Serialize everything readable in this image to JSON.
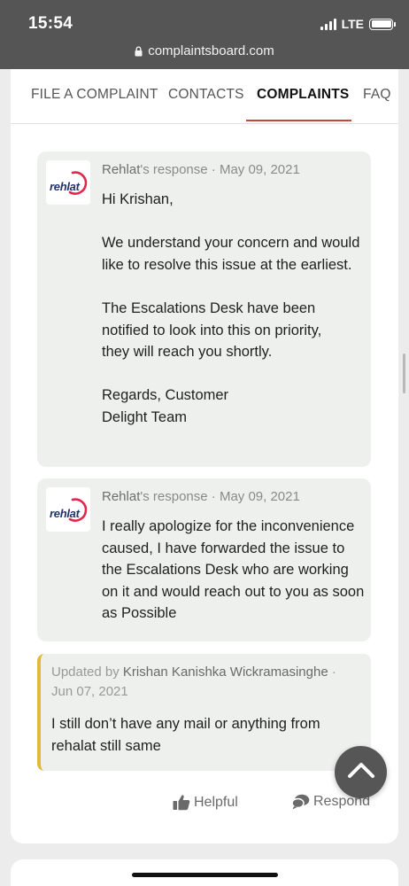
{
  "status_bar": {
    "time": "15:54",
    "network": "LTE"
  },
  "browser": {
    "url": "complaintsboard.com"
  },
  "nav": {
    "tabs": [
      {
        "label": "FILE A COMPLAINT"
      },
      {
        "label": "CONTACTS"
      },
      {
        "label": "COMPLAINTS"
      },
      {
        "label": "FAQ"
      }
    ],
    "active_tab": "COMPLAINTS"
  },
  "responses": [
    {
      "company": "Rehlat",
      "suffix": "'s response",
      "date": "· May 09, 2021",
      "logo_text": "rehlat",
      "paragraphs": [
        "Hi Krishan,",
        "We understand your concern and would like to resolve this issue at the earliest.",
        "The Escalations Desk have been notified to look into this on priority, they will reach you shortly.",
        "Regards, Customer Delight Team"
      ]
    },
    {
      "company": "Rehlat",
      "suffix": "'s response",
      "date": "· May 09, 2021",
      "logo_text": "rehlat",
      "paragraphs": [
        "I really apologize for the inconvenience caused, I have forwarded the issue to the Escalations Desk who are working on it and would reach out to you as soon as Possible"
      ]
    }
  ],
  "update": {
    "prefix": "Updated by",
    "author": "Krishan Kanishka Wickramasinghe",
    "sep": "·",
    "date": "Jun 07, 2021",
    "text": "I still don’t have any mail or anything from rehalat still same"
  },
  "actions": {
    "helpful": "Helpful",
    "respond": "Respond"
  },
  "colors": {
    "accent": "#c8453c",
    "update_border": "#e2b93b",
    "bubble": "#eef0ee"
  }
}
